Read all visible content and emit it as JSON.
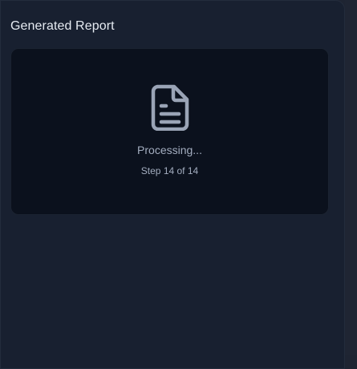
{
  "panel": {
    "title": "Generated Report"
  },
  "report_card": {
    "icon": "document-icon",
    "status": "Processing...",
    "step_text": "Step 14 of 14"
  },
  "colors": {
    "panel_bg": "#182030",
    "card_bg": "#0b111d",
    "title_text": "#e6ebf2",
    "muted_text": "#a3adbf",
    "icon_stroke": "#9aa4b6"
  }
}
